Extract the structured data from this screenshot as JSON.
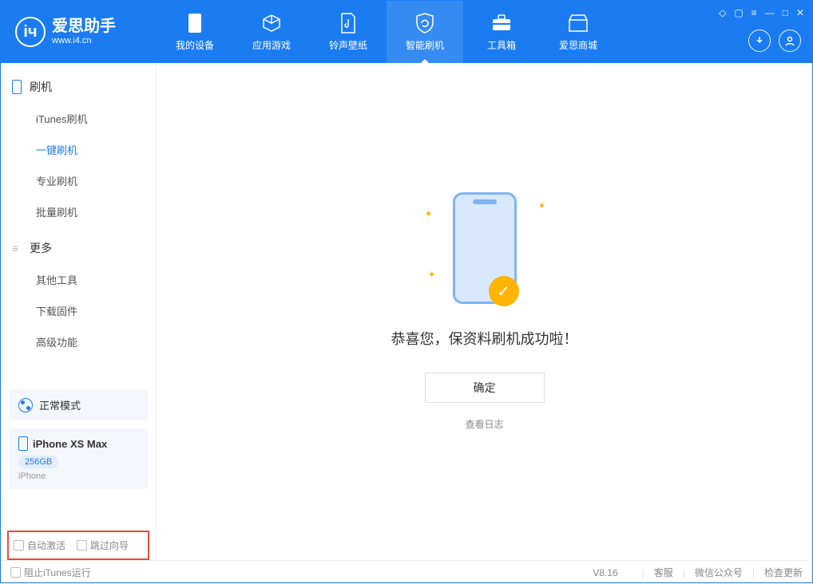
{
  "app": {
    "title": "爱思助手",
    "url": "www.i4.cn"
  },
  "nav": {
    "items": [
      {
        "label": "我的设备"
      },
      {
        "label": "应用游戏"
      },
      {
        "label": "铃声壁纸"
      },
      {
        "label": "智能刷机"
      },
      {
        "label": "工具箱"
      },
      {
        "label": "爱思商城"
      }
    ],
    "activeIndex": 3
  },
  "sidebar": {
    "section1": {
      "title": "刷机",
      "items": [
        "iTunes刷机",
        "一键刷机",
        "专业刷机",
        "批量刷机"
      ],
      "activeIndex": 1
    },
    "section2": {
      "title": "更多",
      "items": [
        "其他工具",
        "下载固件",
        "高级功能"
      ]
    }
  },
  "mode": {
    "label": "正常模式"
  },
  "device": {
    "name": "iPhone XS Max",
    "capacity": "256GB",
    "type": "iPhone"
  },
  "checks": {
    "autoActivate": "自动激活",
    "skipGuide": "跳过向导"
  },
  "main": {
    "successText": "恭喜您，保资料刷机成功啦！",
    "okButton": "确定",
    "logLink": "查看日志"
  },
  "footer": {
    "blockItunes": "阻止iTunes运行",
    "version": "V8.16",
    "links": [
      "客服",
      "微信公众号",
      "检查更新"
    ]
  }
}
